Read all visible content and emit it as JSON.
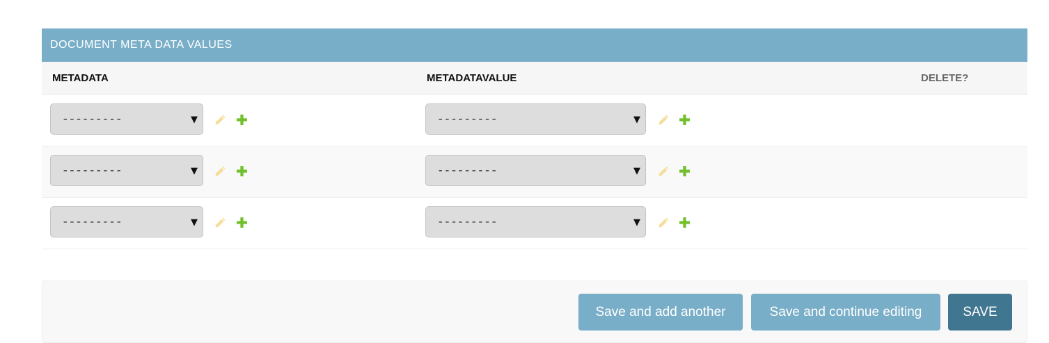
{
  "inline": {
    "title": "DOCUMENT META DATA VALUES",
    "columns": {
      "metadata": "METADATA",
      "value": "METADATAVALUE",
      "delete": "DELETE?"
    },
    "rows": [
      {
        "metadata_selected": "---------",
        "value_selected": "---------"
      },
      {
        "metadata_selected": "---------",
        "value_selected": "---------"
      },
      {
        "metadata_selected": "---------",
        "value_selected": "---------"
      }
    ]
  },
  "icons": {
    "caret": "▼",
    "edit": "pencil-icon",
    "add": "plus-icon",
    "edit_color": "#f5dd9a",
    "add_color": "#70bf2b"
  },
  "colors": {
    "header_bg": "#79aec8",
    "button_light": "#79aec8",
    "button_dark": "#417690"
  },
  "submit": {
    "save_add_another": "Save and add another",
    "save_continue": "Save and continue editing",
    "save": "SAVE"
  }
}
